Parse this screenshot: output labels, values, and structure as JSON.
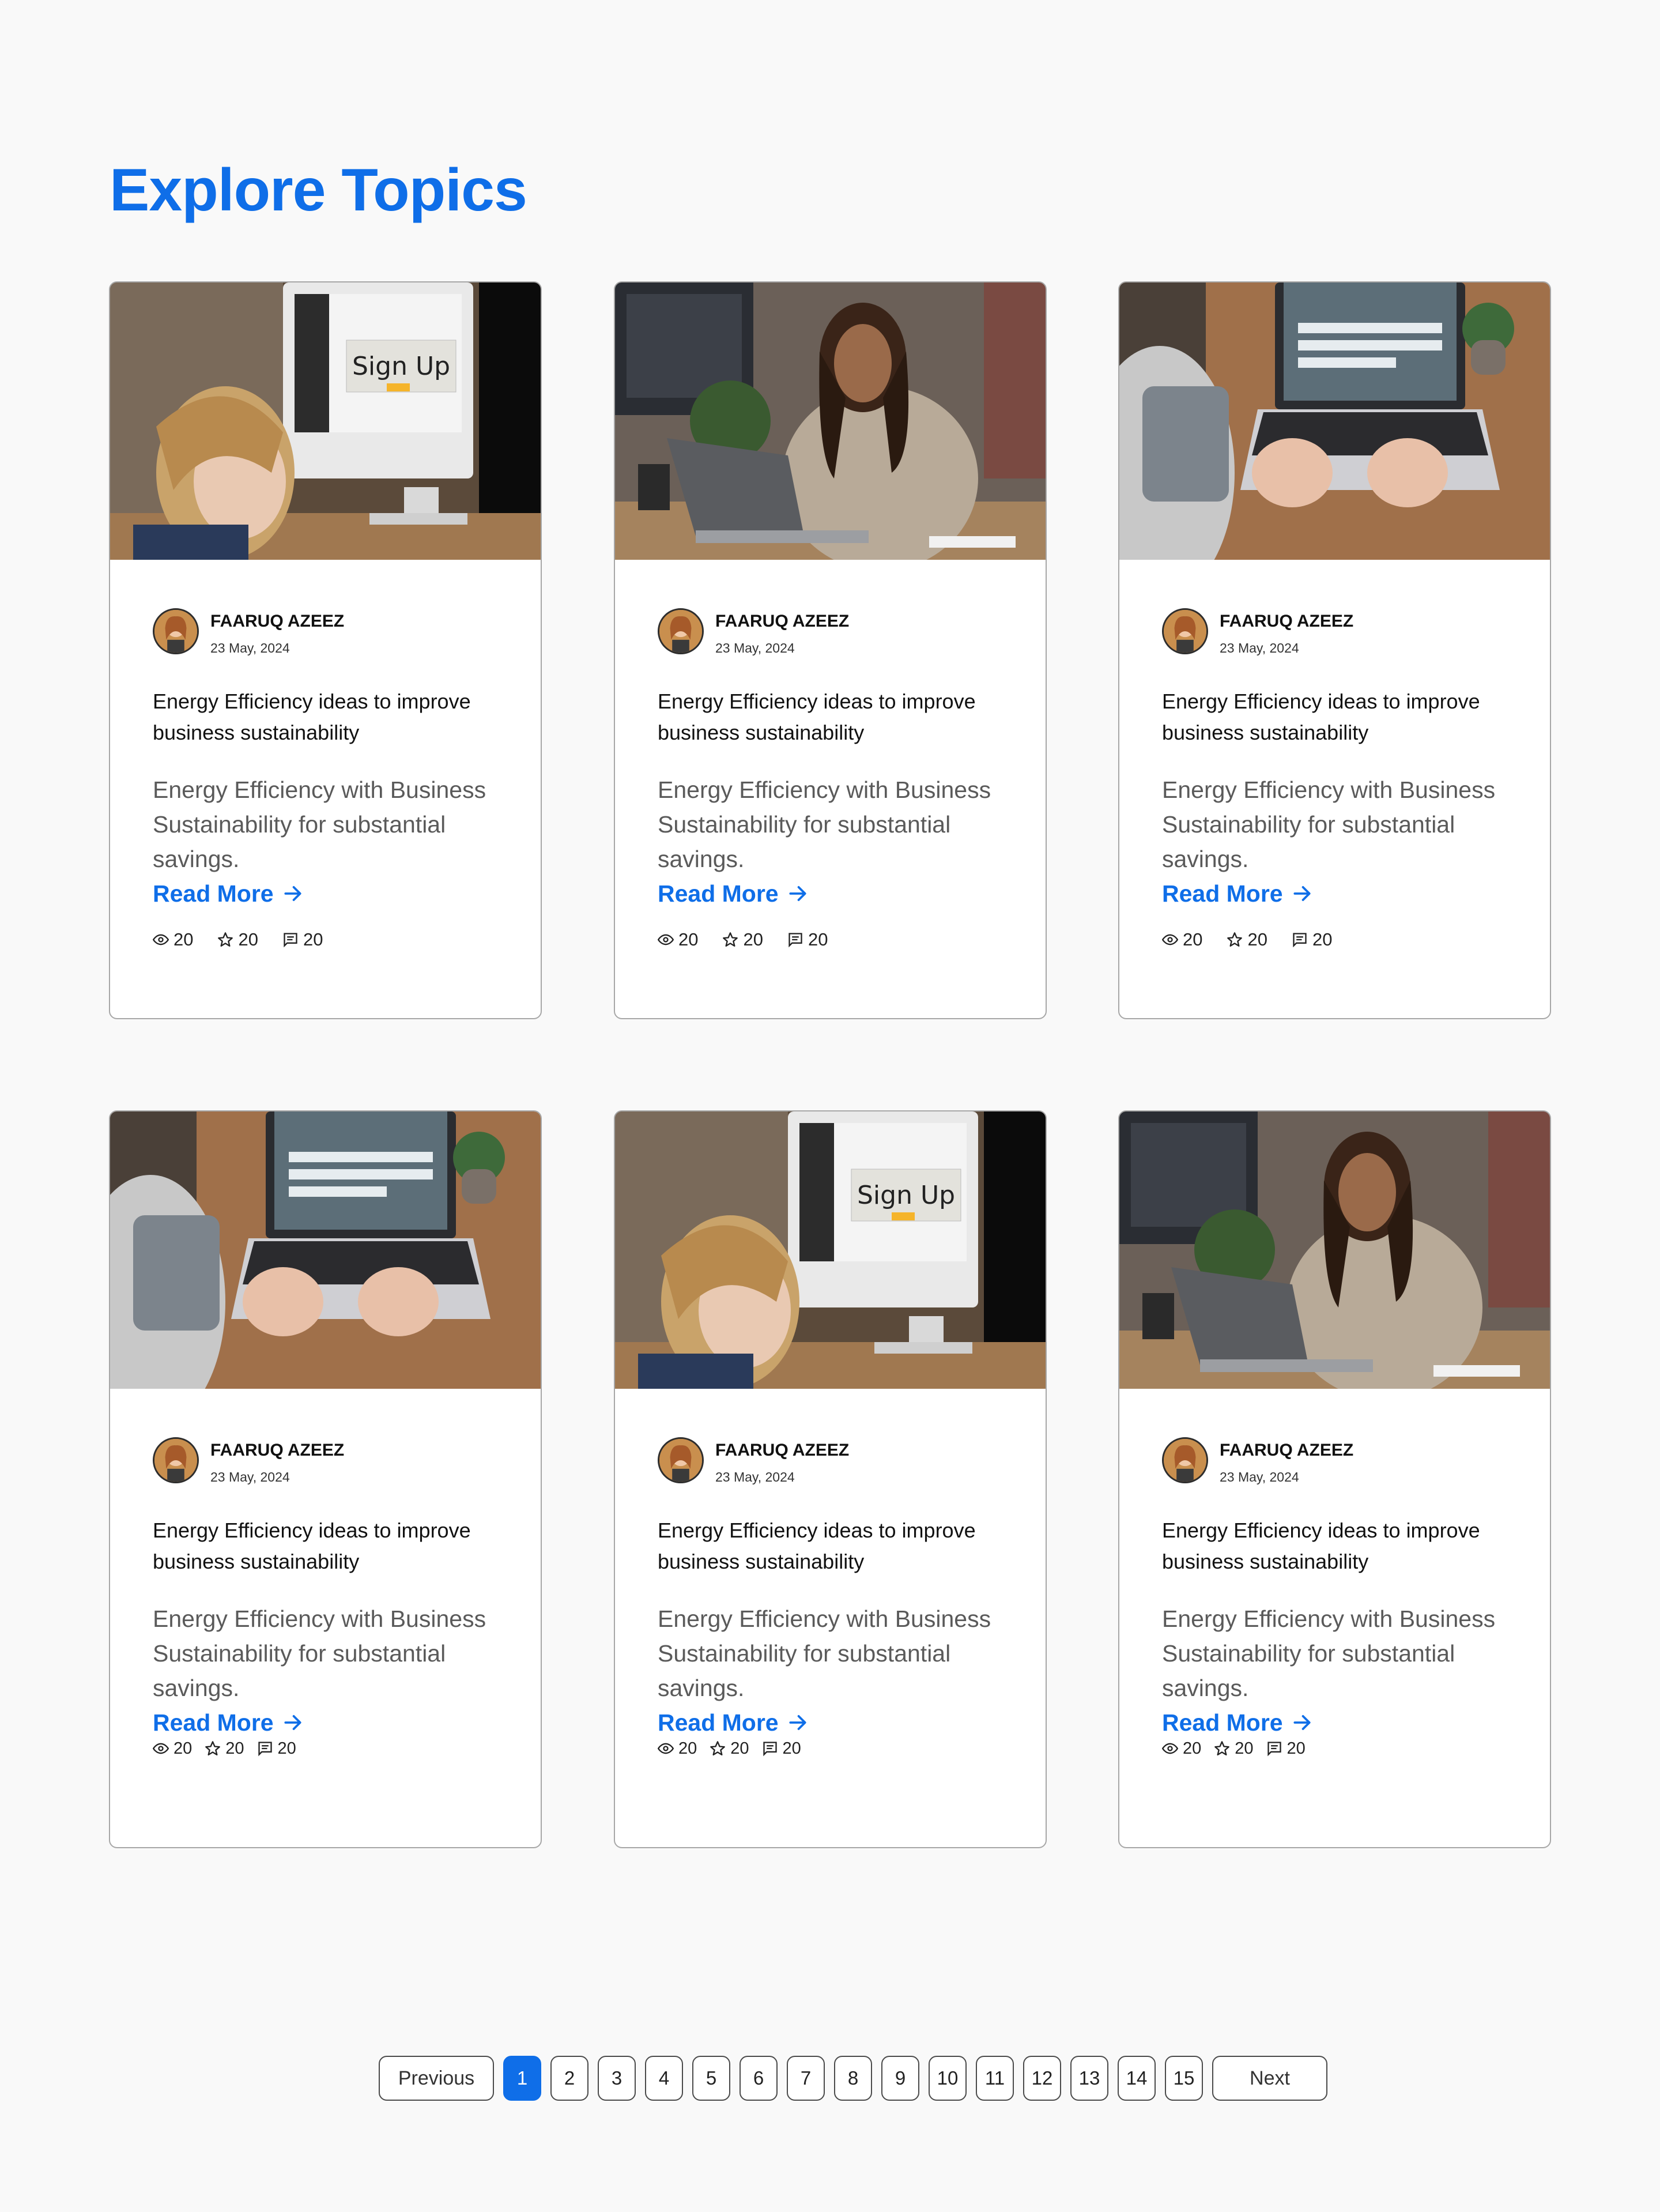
{
  "page": {
    "title": "Explore Topics"
  },
  "cards": [
    {
      "image": "woman-at-desktop-signup",
      "author": "FAARUQ AZEEZ",
      "date": "23 May, 2024",
      "title": "Energy Efficiency ideas to improve business sustainability",
      "description": "Energy Efficiency with Business Sustainability for substantial savings.",
      "read_more": "Read More",
      "views": "20",
      "stars": "20",
      "comments": "20"
    },
    {
      "image": "woman-with-laptop",
      "author": "FAARUQ AZEEZ",
      "date": "23 May, 2024",
      "title": "Energy Efficiency ideas to improve business sustainability",
      "description": "Energy Efficiency with Business Sustainability for substantial savings.",
      "read_more": "Read More",
      "views": "20",
      "stars": "20",
      "comments": "20"
    },
    {
      "image": "hands-typing-laptop",
      "author": "FAARUQ AZEEZ",
      "date": "23 May, 2024",
      "title": "Energy Efficiency ideas to improve business sustainability",
      "description": "Energy Efficiency with Business Sustainability for substantial savings.",
      "read_more": "Read More",
      "views": "20",
      "stars": "20",
      "comments": "20"
    },
    {
      "image": "hands-typing-laptop",
      "author": "FAARUQ AZEEZ",
      "date": "23 May, 2024",
      "title": "Energy Efficiency ideas to improve business sustainability",
      "description": "Energy Efficiency with Business Sustainability for substantial savings.",
      "read_more": "Read More",
      "views": "20",
      "stars": "20",
      "comments": "20"
    },
    {
      "image": "woman-at-desktop-signup",
      "author": "FAARUQ AZEEZ",
      "date": "23 May, 2024",
      "title": "Energy Efficiency ideas to improve business sustainability",
      "description": "Energy Efficiency with Business Sustainability for substantial savings.",
      "read_more": "Read More",
      "views": "20",
      "stars": "20",
      "comments": "20"
    },
    {
      "image": "woman-with-laptop",
      "author": "FAARUQ AZEEZ",
      "date": "23 May, 2024",
      "title": "Energy Efficiency ideas to improve business sustainability",
      "description": "Energy Efficiency with Business Sustainability for substantial savings.",
      "read_more": "Read More",
      "views": "20",
      "stars": "20",
      "comments": "20"
    }
  ],
  "signup_screen_text": "Sign Up",
  "pagination": {
    "previous": "Previous",
    "next": "Next",
    "pages": [
      "1",
      "2",
      "3",
      "4",
      "5",
      "6",
      "7",
      "8",
      "9",
      "10",
      "11",
      "12",
      "13",
      "14",
      "15"
    ],
    "current": "1"
  },
  "colors": {
    "accent": "#0f6ee8",
    "background": "#f9f9f9",
    "card_border": "#a7a7a7"
  }
}
